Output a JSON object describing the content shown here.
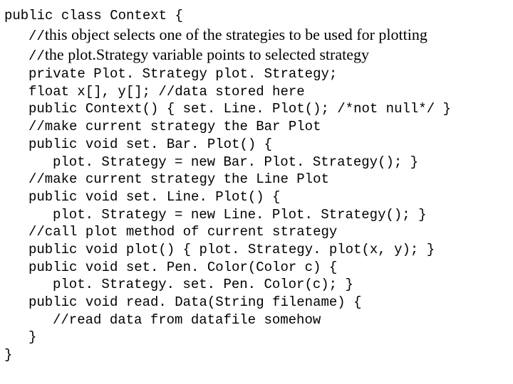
{
  "code": {
    "l1_mono": "public class Context {",
    "l2_mono_prefix": "//",
    "l2_serif": "this object selects one of the strategies to be used for plotting",
    "l3_mono_prefix": "//",
    "l3_serif": "the plot.Strategy variable points to selected strategy",
    "l4": "private Plot. Strategy plot. Strategy;",
    "l5": "float x[], y[]; //data stored here",
    "l6": "public Context() { set. Line. Plot(); /*not null*/ }",
    "l7": "//make current strategy the Bar Plot",
    "l8": "public void set. Bar. Plot() {",
    "l9": "plot. Strategy = new Bar. Plot. Strategy(); }",
    "l10": "//make current strategy the Line Plot",
    "l11": "public void set. Line. Plot() {",
    "l12": "plot. Strategy = new Line. Plot. Strategy(); }",
    "l13": "//call plot method of current strategy",
    "l14": "public void plot() { plot. Strategy. plot(x, y); }",
    "l15": "public void set. Pen. Color(Color c) {",
    "l16": "plot. Strategy. set. Pen. Color(c); }",
    "l17": "public void read. Data(String filename) {",
    "l18": "//read data from datafile somehow",
    "l19": "}",
    "l20": "}"
  }
}
